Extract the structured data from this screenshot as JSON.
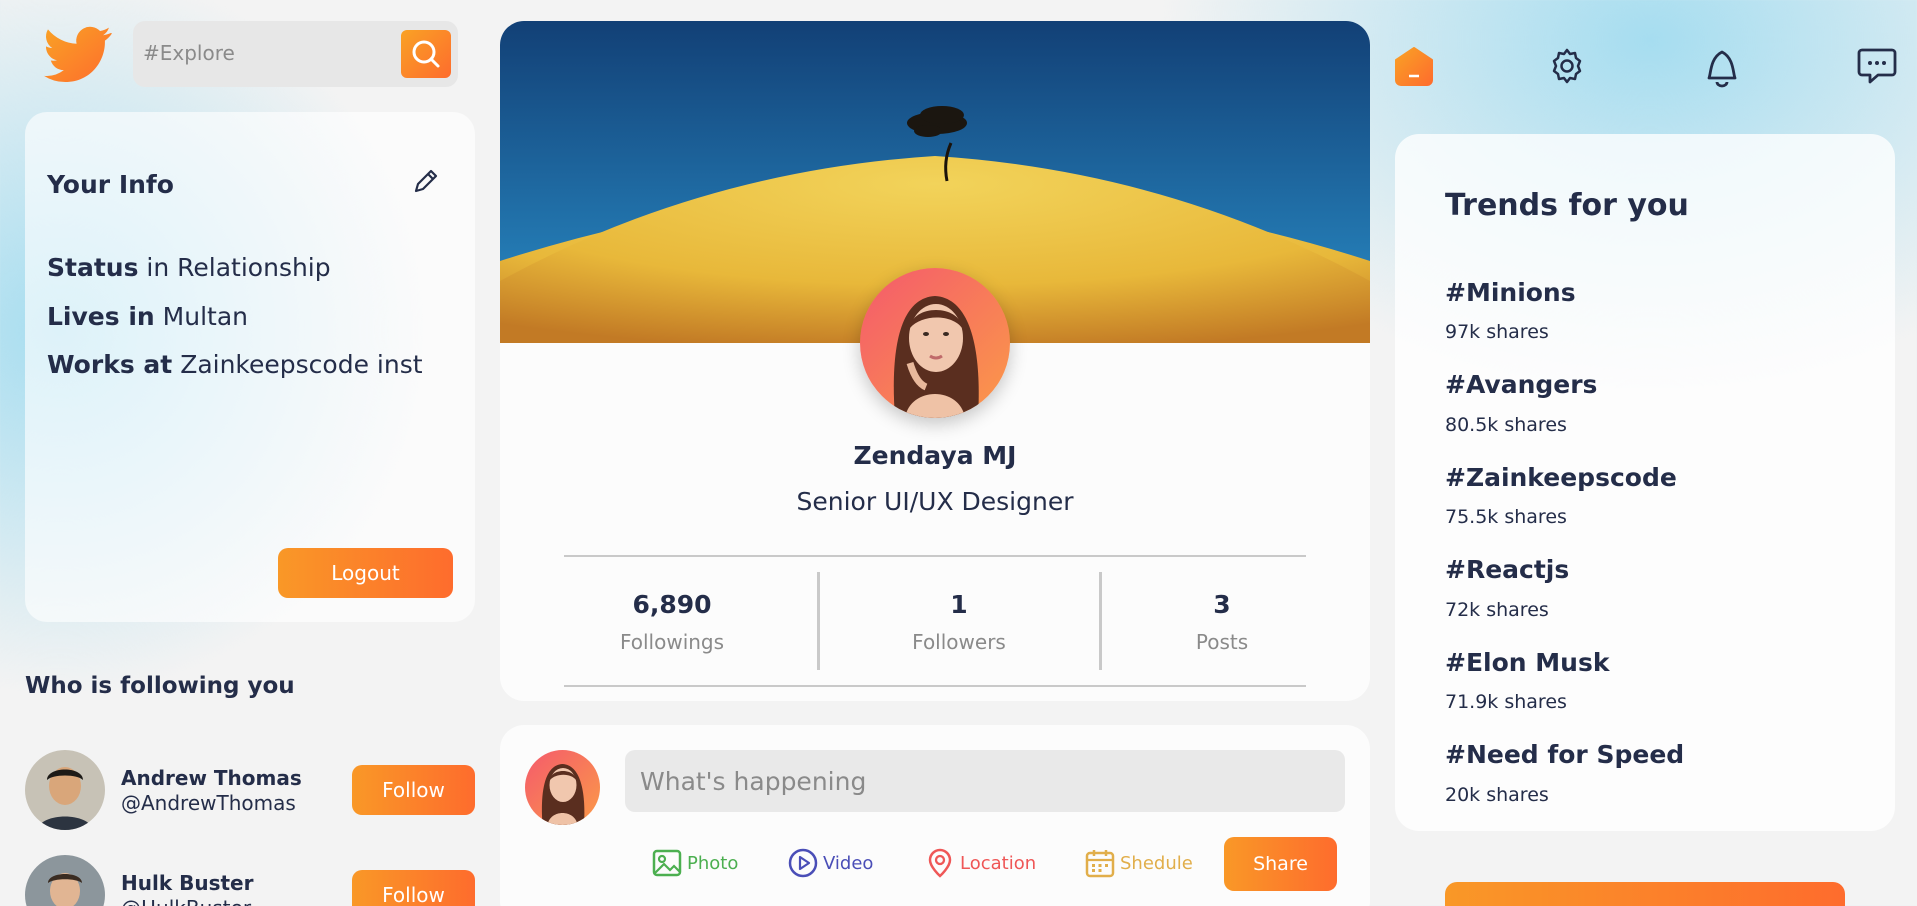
{
  "search": {
    "placeholder": "#Explore"
  },
  "info": {
    "title": "Your Info",
    "rows": [
      {
        "label": "Status",
        "value": "in Relationship"
      },
      {
        "label": "Lives in",
        "value": "Multan"
      },
      {
        "label": "Works at",
        "value": "Zainkeepscode inst"
      }
    ],
    "logout_label": "Logout"
  },
  "followers": {
    "title": "Who is following you",
    "items": [
      {
        "name": "Andrew Thomas",
        "handle": "@AndrewThomas",
        "button": "Follow"
      },
      {
        "name": "Hulk Buster",
        "handle": "@HulkBuster",
        "button": "Follow"
      }
    ]
  },
  "profile": {
    "name": "Zendaya MJ",
    "role": "Senior UI/UX Designer",
    "stats": [
      {
        "value": "6,890",
        "label": "Followings"
      },
      {
        "value": "1",
        "label": "Followers"
      },
      {
        "value": "3",
        "label": "Posts"
      }
    ]
  },
  "post": {
    "placeholder": "What's happening",
    "options": [
      {
        "label": "Photo",
        "icon": "photo-icon",
        "color": "#4caf50"
      },
      {
        "label": "Video",
        "icon": "video-icon",
        "color": "#4a4eb7"
      },
      {
        "label": "Location",
        "icon": "location-icon",
        "color": "#ef5757"
      },
      {
        "label": "Shedule",
        "icon": "calendar-icon",
        "color": "#e1ae4a"
      }
    ],
    "share_label": "Share"
  },
  "trends": {
    "title": "Trends for you",
    "items": [
      {
        "tag": "#Minions",
        "shares": "97k shares"
      },
      {
        "tag": "#Avangers",
        "shares": "80.5k shares"
      },
      {
        "tag": "#Zainkeepscode",
        "shares": "75.5k shares"
      },
      {
        "tag": "#Reactjs",
        "shares": "72k shares"
      },
      {
        "tag": "#Elon Musk",
        "shares": "71.9k shares"
      },
      {
        "tag": "#Need for Speed",
        "shares": "20k shares"
      }
    ]
  },
  "colors": {
    "accent_start": "#f9a225",
    "accent_end": "#fe6c2d",
    "text": "#242d49",
    "muted": "#8a8a8a"
  }
}
